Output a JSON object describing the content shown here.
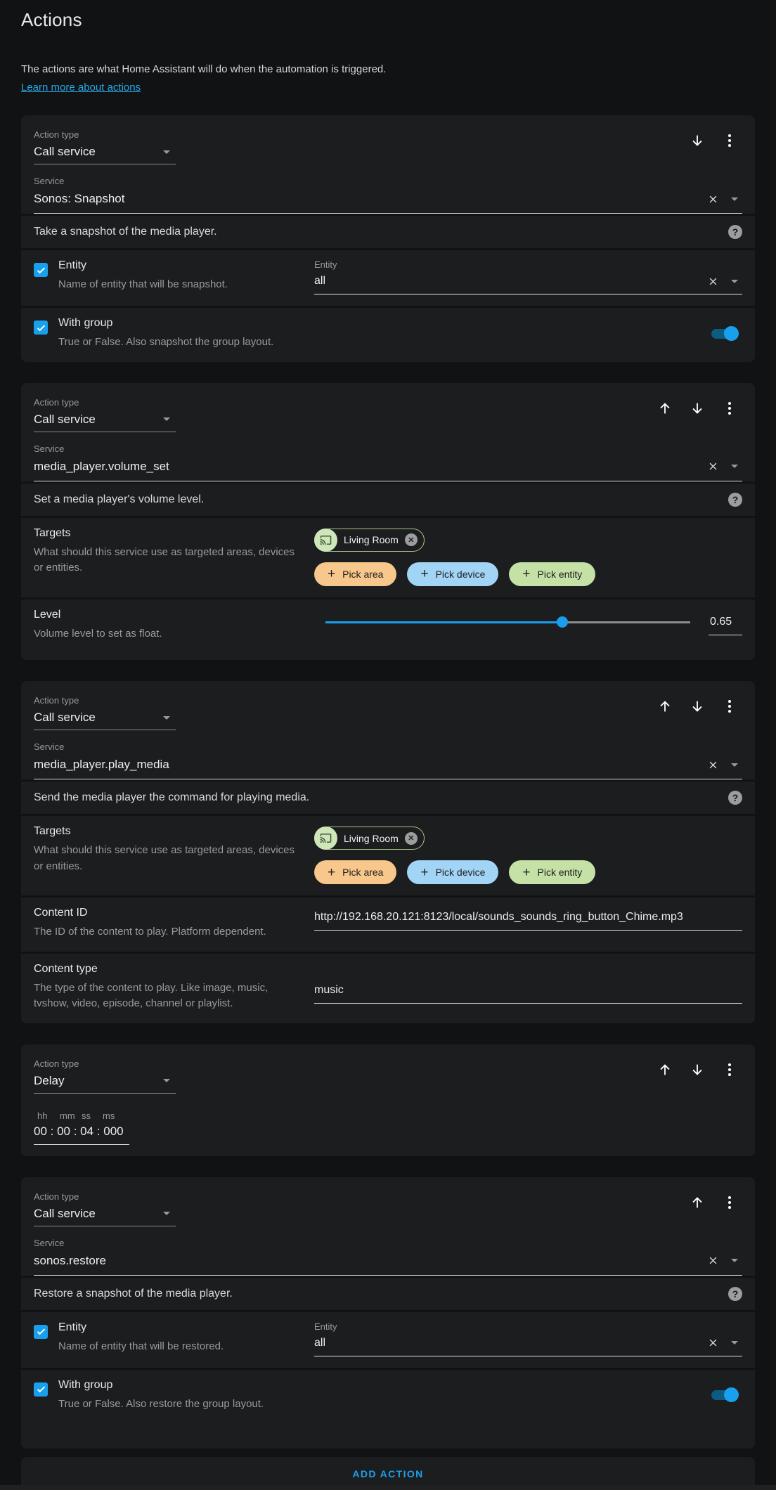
{
  "page": {
    "title": "Actions",
    "description": "The actions are what Home Assistant will do when the automation is triggered.",
    "link": "Learn more about actions",
    "add_action": "ADD ACTION"
  },
  "labels": {
    "action_type": "Action type",
    "service": "Service"
  },
  "colors": {
    "accent": "#18a0ef",
    "background": "#111213",
    "card": "#1c1d1e",
    "pick_area": "#f7c78b",
    "pick_device": "#a2d4f5",
    "pick_entity": "#c5e1a6"
  },
  "cards": [
    {
      "action_type": "Call service",
      "service": "Sonos: Snapshot",
      "description": "Take a snapshot of the media player.",
      "rows": [
        {
          "title": "Entity",
          "subtitle": "Name of entity that will be snapshot.",
          "field_label": "Entity",
          "value": "all",
          "checked": true
        },
        {
          "title": "With group",
          "subtitle": "True or False. Also snapshot the group layout.",
          "checked": true,
          "toggle_on": true
        }
      ]
    },
    {
      "action_type": "Call service",
      "service": "media_player.volume_set",
      "description": "Set a media player's volume level.",
      "targets": {
        "title": "Targets",
        "subtitle": "What should this service use as targeted areas, devices or entities.",
        "chip": "Living Room",
        "buttons": [
          "Pick area",
          "Pick device",
          "Pick entity"
        ]
      },
      "level": {
        "title": "Level",
        "subtitle": "Volume level to set as float.",
        "value": "0.65",
        "fill": "65%"
      }
    },
    {
      "action_type": "Call service",
      "service": "media_player.play_media",
      "description": "Send the media player the command for playing media.",
      "targets": {
        "title": "Targets",
        "subtitle": "What should this service use as targeted areas, devices or entities.",
        "chip": "Living Room",
        "buttons": [
          "Pick area",
          "Pick device",
          "Pick entity"
        ]
      },
      "content_id": {
        "title": "Content ID",
        "subtitle": "The ID of the content to play. Platform dependent.",
        "value": "http://192.168.20.121:8123/local/sounds_sounds_ring_button_Chime.mp3"
      },
      "content_type": {
        "title": "Content type",
        "subtitle": "The type of the content to play. Like image, music, tvshow, video, episode, channel or playlist.",
        "value": "music"
      }
    },
    {
      "action_type": "Delay",
      "duration": {
        "units": [
          "hh",
          "mm",
          "ss",
          "ms"
        ],
        "value": "00 : 00 : 04 : 000"
      }
    },
    {
      "action_type": "Call service",
      "service": "sonos.restore",
      "description": "Restore a snapshot of the media player.",
      "rows": [
        {
          "title": "Entity",
          "subtitle": "Name of entity that will be restored.",
          "field_label": "Entity",
          "value": "all",
          "checked": true
        },
        {
          "title": "With group",
          "subtitle": "True or False. Also restore the group layout.",
          "checked": true,
          "toggle_on": true
        }
      ]
    }
  ]
}
